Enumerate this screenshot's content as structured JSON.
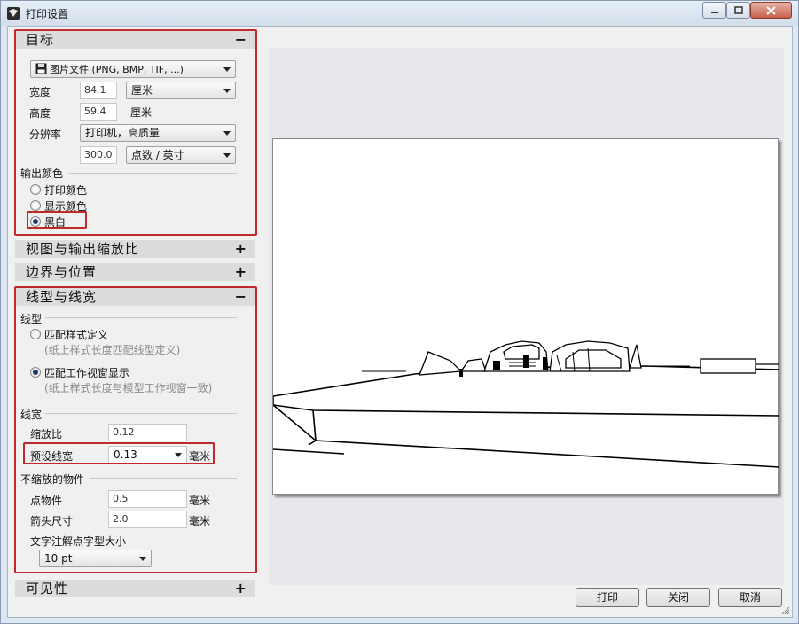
{
  "window": {
    "title": "打印设置",
    "icons": [
      "app-icon",
      "minimize-icon",
      "maximize-icon",
      "close-icon"
    ]
  },
  "target": {
    "header": "目标",
    "toggle": "−",
    "destination": "图片文件 (PNG, BMP, TIF, ...)",
    "width_label": "宽度",
    "width_value": "84.1",
    "width_unit": "厘米",
    "height_label": "高度",
    "height_value": "59.4",
    "height_unit": "厘米",
    "resolution_label": "分辨率",
    "resolution_mode": "打印机，高质量",
    "resolution_value": "300.0",
    "resolution_unit": "点数 / 英寸",
    "output_color_label": "输出颜色",
    "color_options": [
      "打印颜色",
      "显示颜色",
      "黑白"
    ],
    "color_selected": "黑白"
  },
  "view_scale": {
    "header": "视图与输出缩放比",
    "toggle": "+"
  },
  "margins": {
    "header": "边界与位置",
    "toggle": "+"
  },
  "linetypes": {
    "header": "线型与线宽",
    "toggle": "−",
    "linetype_label": "线型",
    "option1_label": "匹配样式定义",
    "option1_note": "(纸上样式长度匹配线型定义)",
    "option2_label": "匹配工作视窗显示",
    "option2_note": "(纸上样式长度与模型工作视窗一致)",
    "linetype_selected": "匹配工作视窗显示",
    "lineweight_label": "线宽",
    "scale_label": "缩放比",
    "scale_value": "0.12",
    "default_weight_label": "预设线宽",
    "default_weight_value": "0.13",
    "default_weight_unit": "毫米",
    "nonscaling_label": "不缩放的物件",
    "point_label": "点物件",
    "point_value": "0.5",
    "point_unit": "毫米",
    "arrow_label": "箭头尺寸",
    "arrow_value": "2.0",
    "arrow_unit": "毫米",
    "textdot_label": "文字注解点字型大小",
    "textdot_value": "10 pt"
  },
  "visibility": {
    "header": "可见性",
    "toggle": "+"
  },
  "buttons": {
    "print": "打印",
    "close": "关闭",
    "cancel": "取消"
  },
  "colors": {
    "highlight_box": "#c0282c",
    "selected_radio": "#1d3a74"
  }
}
